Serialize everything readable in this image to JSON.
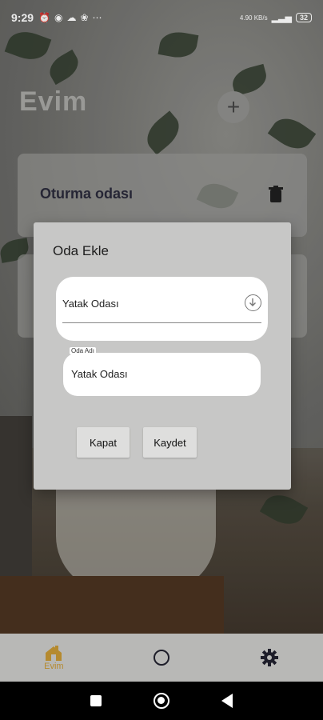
{
  "status_bar": {
    "time": "9:29",
    "left_icons": [
      "alarm-icon",
      "game-icon",
      "cloud-icon",
      "fan-icon",
      "more-icon"
    ],
    "more": "⋯",
    "right_text": "4.90 KB/s",
    "battery": "32"
  },
  "header": {
    "title": "Evim",
    "add_icon": "plus-icon",
    "add_glyph": "+"
  },
  "rooms": [
    {
      "name": "Oturma odası",
      "delete_icon": "trash-icon"
    }
  ],
  "dialog": {
    "title": "Oda Ekle",
    "room_type_select": {
      "value": "Yatak Odası",
      "icon": "chevron-down-circle-icon"
    },
    "room_name_field": {
      "label": "Oda Adı",
      "value": "Yatak Odası"
    },
    "buttons": {
      "close": "Kapat",
      "save": "Kaydet"
    }
  },
  "bottom_nav": {
    "items": [
      {
        "label": "Evim",
        "icon": "home-icon",
        "active": true
      },
      {
        "label": "",
        "icon": "circle-icon",
        "active": false
      },
      {
        "label": "",
        "icon": "gear-icon",
        "active": false
      }
    ]
  },
  "colors": {
    "accent": "#b58a2f",
    "nav_dark": "#1e1e2a"
  }
}
